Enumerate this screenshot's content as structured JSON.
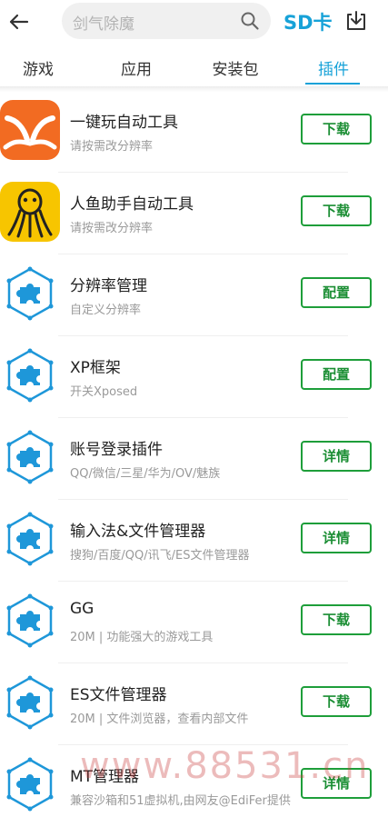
{
  "header": {
    "search_placeholder": "剑气除魔",
    "sd_label": "SD卡"
  },
  "tabs": [
    {
      "label": "游戏"
    },
    {
      "label": "应用"
    },
    {
      "label": "安装包"
    },
    {
      "label": "插件",
      "active": true
    }
  ],
  "apps": [
    {
      "title": "一键玩自动工具",
      "subtitle": "请按需改分辨率",
      "button": "下载",
      "icon": "orange-y-logo-icon"
    },
    {
      "title": "人鱼助手自动工具",
      "subtitle": "请按需改分辨率",
      "button": "下载",
      "icon": "mermaid-logo-icon"
    },
    {
      "title": "分辨率管理",
      "subtitle": "自定义分辨率",
      "button": "配置",
      "icon": "puzzle-hexagon-icon"
    },
    {
      "title": "XP框架",
      "subtitle": "开关Xposed",
      "button": "配置",
      "icon": "puzzle-hexagon-icon"
    },
    {
      "title": "账号登录插件",
      "subtitle": "QQ/微信/三星/华为/OV/魅族",
      "button": "详情",
      "icon": "puzzle-hexagon-icon"
    },
    {
      "title": "输入法&文件管理器",
      "subtitle": "搜狗/百度/QQ/讯飞/ES文件管理器",
      "button": "详情",
      "icon": "puzzle-hexagon-icon"
    },
    {
      "title": "GG",
      "subtitle": "20M | 功能强大的游戏工具",
      "button": "下载",
      "icon": "puzzle-hexagon-icon"
    },
    {
      "title": "ES文件管理器",
      "subtitle": "20M | 文件浏览器，查看内部文件",
      "button": "下载",
      "icon": "puzzle-hexagon-icon"
    },
    {
      "title": "MT管理器",
      "subtitle": "兼容沙箱和51虚拟机,由网友@EdiFer提供",
      "button": "详情",
      "icon": "puzzle-hexagon-icon"
    }
  ],
  "watermark": "www.88531.cn",
  "colors": {
    "accent": "#17a2d8",
    "button_green": "#1e9e3a"
  }
}
